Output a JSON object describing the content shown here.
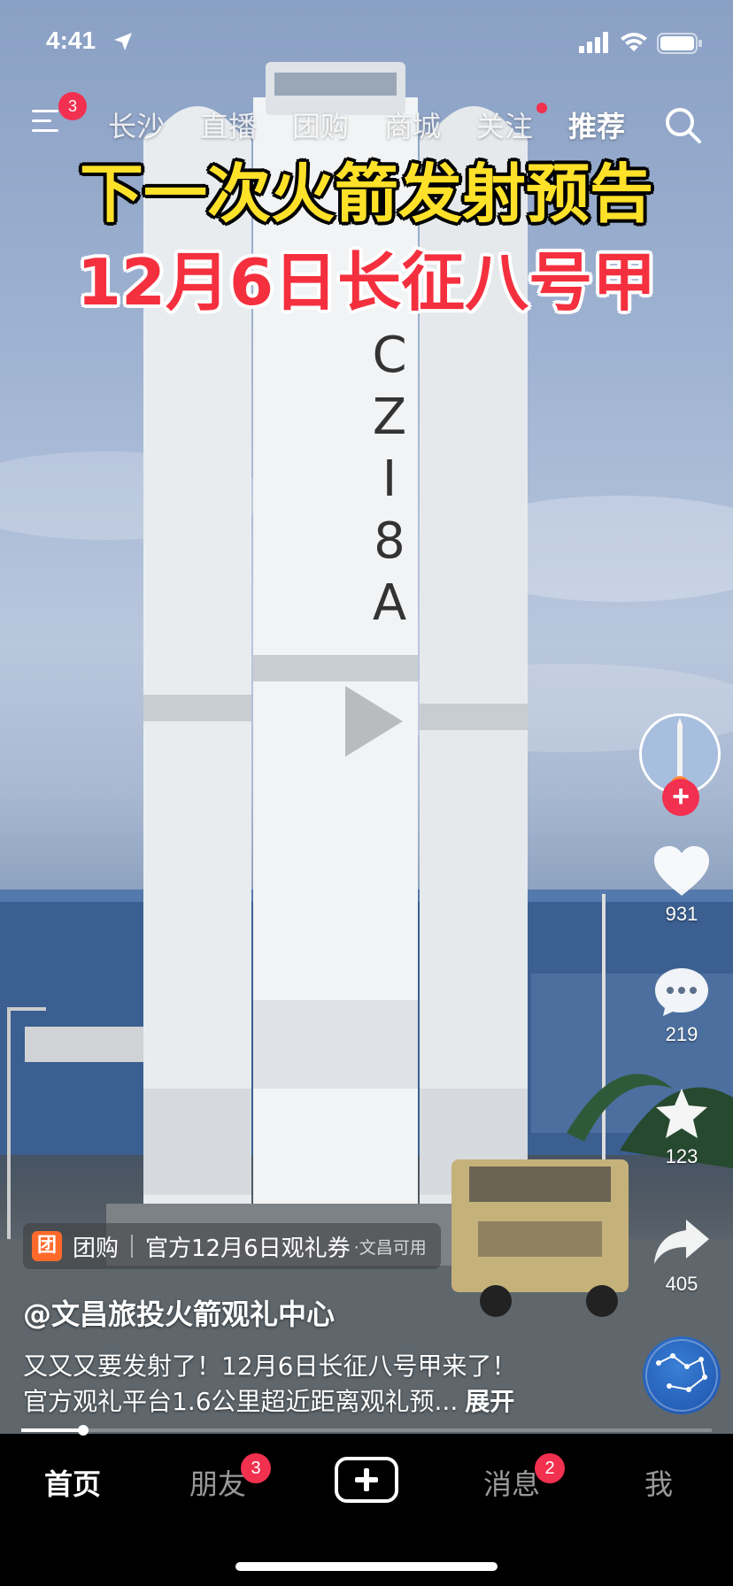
{
  "status_bar": {
    "time": "4:41"
  },
  "top_nav": {
    "menu_badge": "3",
    "tabs": [
      {
        "label": "长沙"
      },
      {
        "label": "直播"
      },
      {
        "label": "团购"
      },
      {
        "label": "商城"
      },
      {
        "label": "关注"
      },
      {
        "label": "推荐"
      }
    ],
    "active_tab": "推荐"
  },
  "video": {
    "headline_1": "下一次火箭发射预告",
    "headline_2": "12月6日长征八号甲",
    "rocket_label": "CZ-8A"
  },
  "actions": {
    "likes": "931",
    "comments": "219",
    "favorites": "123",
    "shares": "405"
  },
  "tuangou": {
    "icon_text": "团",
    "label": "团购",
    "title": "官方12月6日观礼券",
    "subtitle": "·文昌可用"
  },
  "post": {
    "author": "@文昌旅投火箭观礼中心",
    "caption_line1": "又又又要发射了！12月6日长征八号甲来了！",
    "caption_line2": "官方观礼平台1.6公里超近距离观礼预...",
    "expand_label": "展开",
    "progress": 0.09
  },
  "tab_bar": {
    "home": "首页",
    "friends": "朋友",
    "friends_badge": "3",
    "messages": "消息",
    "messages_badge": "2",
    "me": "我"
  },
  "colors": {
    "accent_red": "#f2304f",
    "headline_yellow": "#ffe12a",
    "headline_red": "#f4303f"
  }
}
